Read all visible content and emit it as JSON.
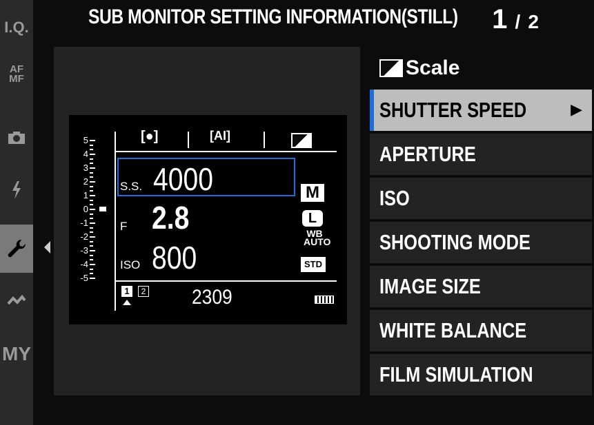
{
  "header": {
    "title": "SUB MONITOR SETTING  INFORMATION(STILL)",
    "page_current": "1",
    "page_sep": "/",
    "page_total": "2"
  },
  "sidebar": {
    "tabs": [
      {
        "name": "iq",
        "label": "I.Q."
      },
      {
        "name": "af-mf",
        "label": "AF MF"
      },
      {
        "name": "camera",
        "icon": "camera-icon"
      },
      {
        "name": "flash",
        "icon": "flash-icon"
      },
      {
        "name": "setup",
        "icon": "wrench-icon",
        "active": true
      },
      {
        "name": "custom",
        "icon": "wave-icon"
      },
      {
        "name": "my",
        "label": "MY"
      }
    ]
  },
  "menu": {
    "heading": "Scale",
    "items": [
      {
        "label": "SHUTTER SPEED",
        "selected": true
      },
      {
        "label": "APERTURE"
      },
      {
        "label": "ISO"
      },
      {
        "label": "SHOOTING MODE"
      },
      {
        "label": "IMAGE SIZE"
      },
      {
        "label": "WHITE BALANCE"
      },
      {
        "label": "FILM SIMULATION"
      }
    ]
  },
  "monitor": {
    "scale_labels": [
      "5",
      "4",
      "3",
      "2",
      "1",
      "0",
      "-1",
      "-2",
      "-3",
      "-4",
      "-5"
    ],
    "ss_label": "S.S.",
    "ss_value": "4000",
    "f_label": "F",
    "f_value": "2.8",
    "iso_label": "ISO",
    "iso_value": "800",
    "frames": "2309",
    "mode_icon": "M",
    "size_icon": "L",
    "wb_top": "WB",
    "wb_bottom": "AUTO",
    "film_icon": "STD",
    "slot1": "1",
    "slot2": "2"
  },
  "colors": {
    "accent": "#1e6fd9",
    "selected_bg": "#bdbdbd",
    "panel_bg": "#232323"
  }
}
